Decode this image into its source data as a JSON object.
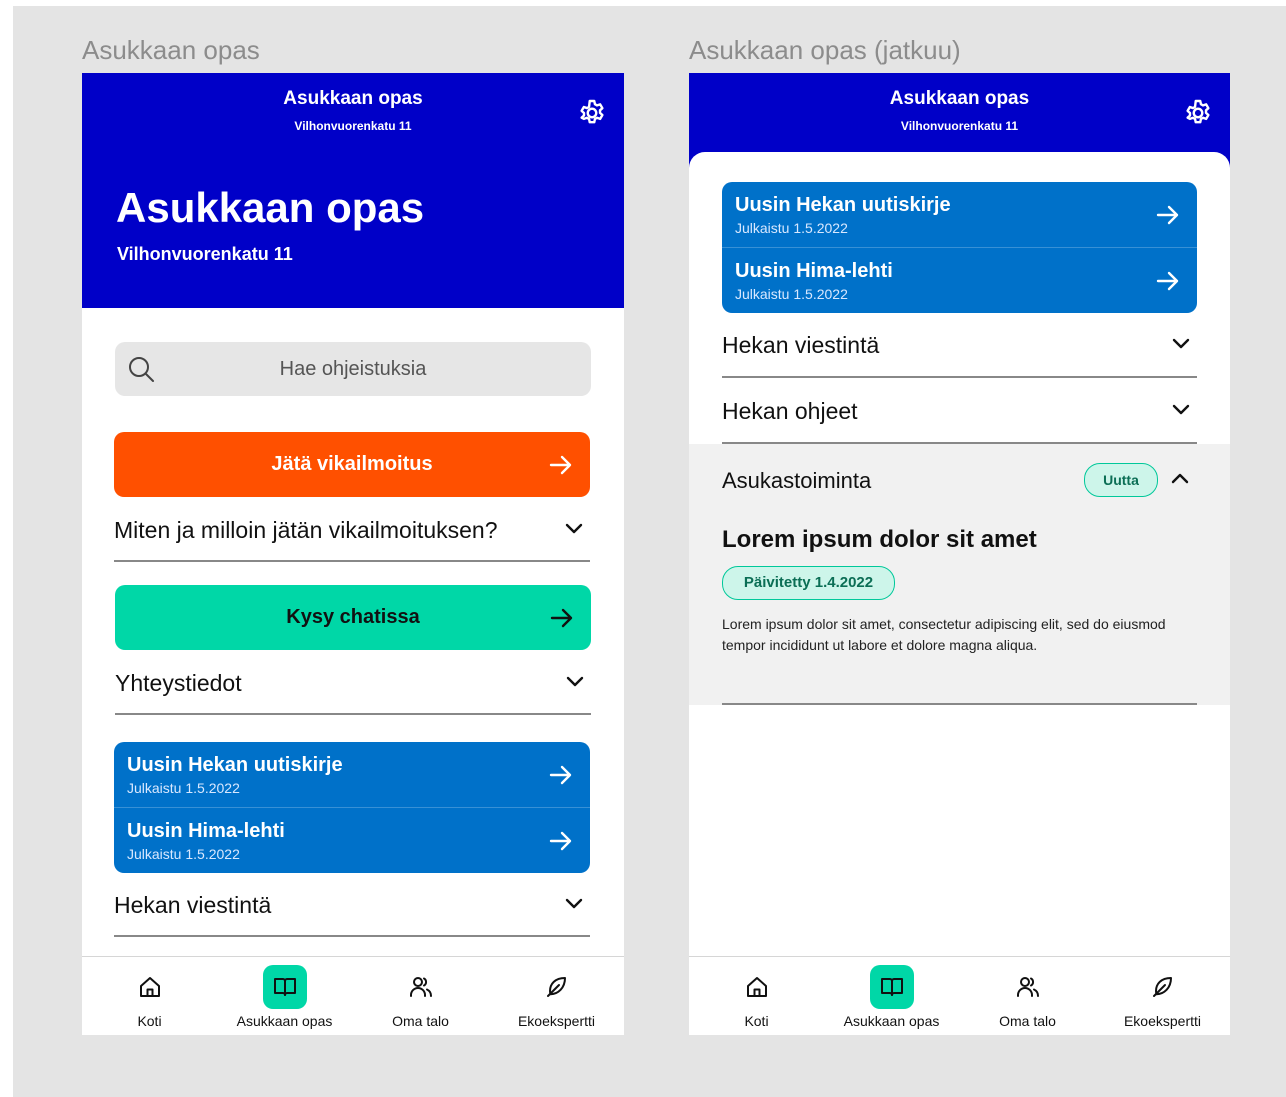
{
  "frames": [
    {
      "title": "Asukkaan opas"
    },
    {
      "title": "Asukkaan opas (jatkuu)"
    }
  ],
  "header": {
    "title": "Asukkaan opas",
    "subtitle": "Vilhonvuorenkatu 11",
    "settings_icon": "gear-icon"
  },
  "hero": {
    "title": "Asukkaan opas",
    "subtitle": "Vilhonvuorenkatu 11"
  },
  "search": {
    "placeholder": "Hae ohjeistuksia",
    "icon": "search-icon"
  },
  "fault_report": {
    "button_label": "Jätä vikailmoitus",
    "question": "Miten ja milloin jätän vikailmoituksen?"
  },
  "chat": {
    "button_label": "Kysy chatissa",
    "contacts": "Yhteystiedot"
  },
  "news": [
    {
      "title": "Uusin Hekan uutiskirje",
      "published": "Julkaistu 1.5.2022"
    },
    {
      "title": "Uusin Hima-lehti",
      "published": "Julkaistu 1.5.2022"
    }
  ],
  "sections": {
    "communication": "Hekan viestintä",
    "instructions": "Hekan ohjeet",
    "resident_activity": {
      "title": "Asukastoiminta",
      "badge": "Uutta",
      "article_title": "Lorem ipsum dolor sit amet",
      "updated": "Päivitetty 1.4.2022",
      "body": "Lorem ipsum dolor sit amet, consectetur adipiscing elit, sed do eiusmod tempor incididunt ut labore et dolore magna aliqua."
    }
  },
  "nav": [
    {
      "label": "Koti",
      "icon": "home-icon"
    },
    {
      "label": "Asukkaan opas",
      "icon": "book-icon",
      "active": true
    },
    {
      "label": "Oma talo",
      "icon": "people-icon"
    },
    {
      "label": "Ekoekspertti",
      "icon": "leaf-icon"
    }
  ],
  "colors": {
    "primary_blue": "#0000c8",
    "news_blue": "#0071c9",
    "orange": "#ff5000",
    "green": "#00d7a7",
    "board": "#e4e4e4"
  }
}
